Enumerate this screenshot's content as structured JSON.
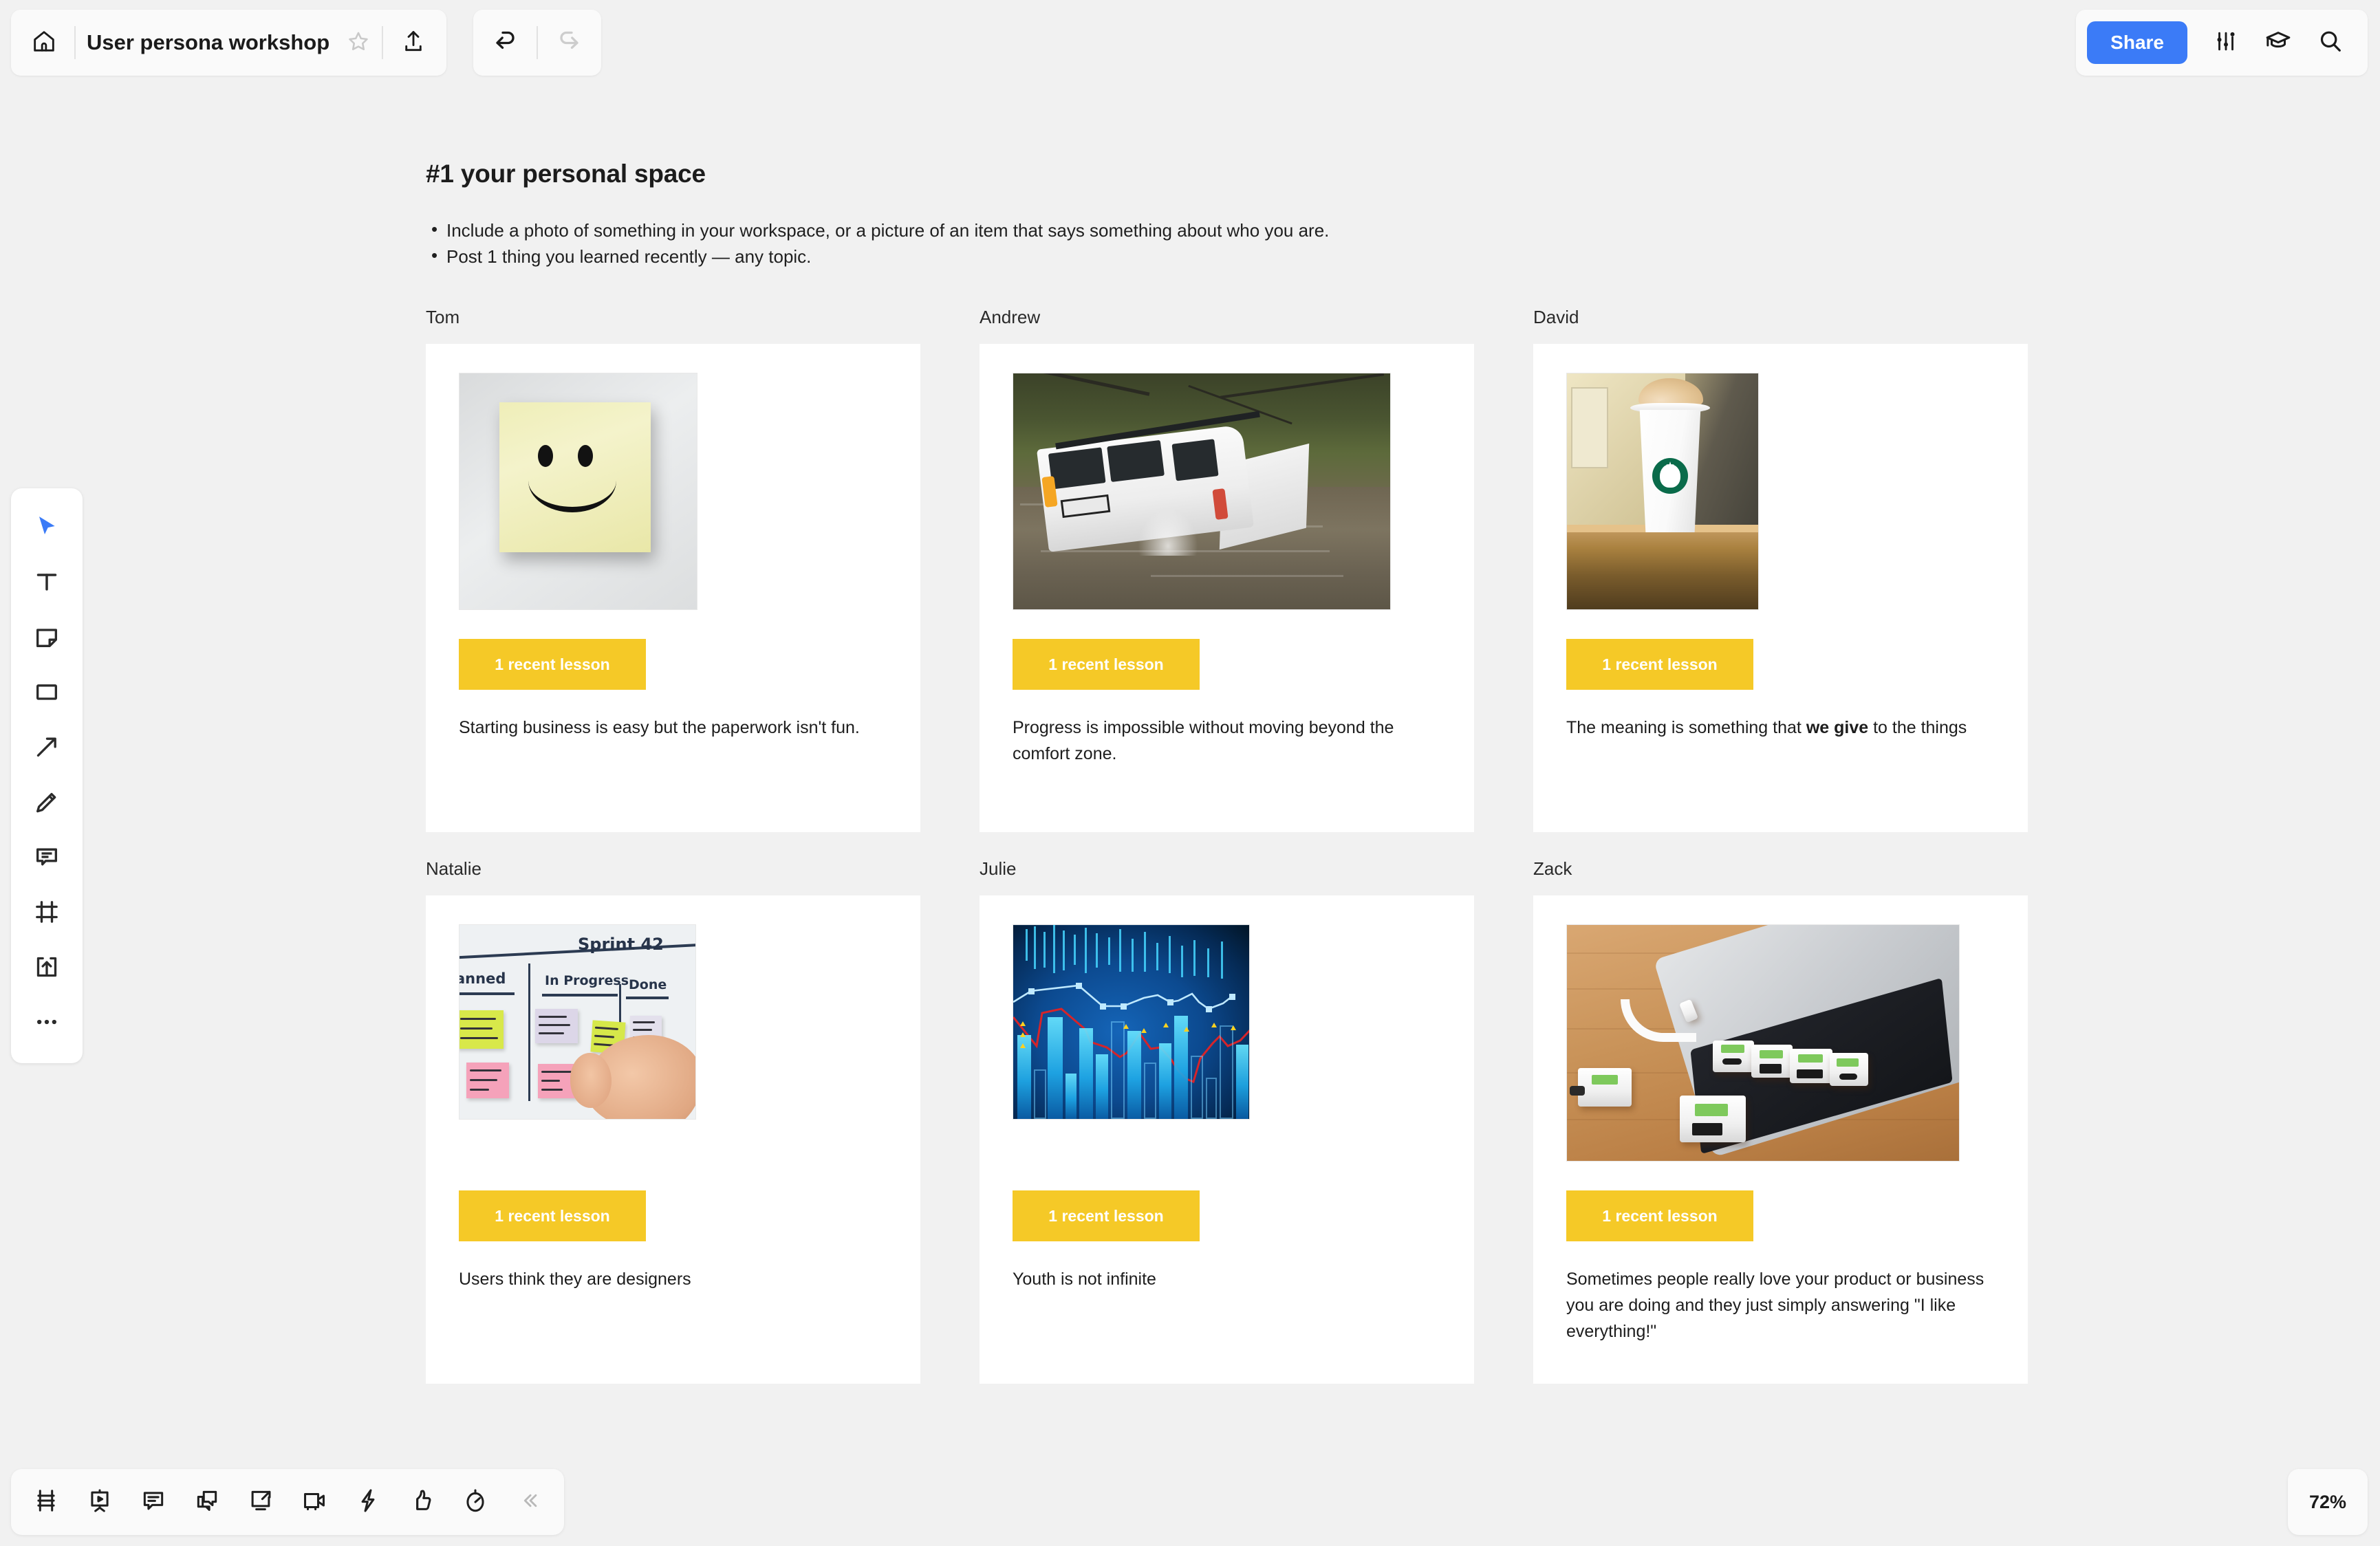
{
  "app": {
    "zoom_level": "72%",
    "accent_blue": "#3b7bf7",
    "sticky_yellow": "#f5c927",
    "canvas_bg": "#f1f1f1"
  },
  "topbar": {
    "home_icon": "home-icon",
    "document_title": "User persona workshop",
    "star_icon": "star-outline-icon",
    "upload_icon": "upload-icon",
    "undo_icon": "undo-arrow-icon",
    "redo_icon": "redo-arrow-icon",
    "share_label": "Share",
    "settings_icon": "sliders-icon",
    "learn_icon": "graduation-cap-icon",
    "search_icon": "magnifier-icon"
  },
  "left_toolbar": {
    "tools": [
      {
        "name": "select-tool",
        "icon": "cursor-arrow-icon",
        "selected": true
      },
      {
        "name": "text-tool",
        "icon": "text-t-icon",
        "selected": false
      },
      {
        "name": "sticky-note-tool",
        "icon": "sticky-note-icon",
        "selected": false
      },
      {
        "name": "shape-tool",
        "icon": "rectangle-icon",
        "selected": false
      },
      {
        "name": "connector-tool",
        "icon": "arrow-line-icon",
        "selected": false
      },
      {
        "name": "pen-tool",
        "icon": "pencil-icon",
        "selected": false
      },
      {
        "name": "comment-tool",
        "icon": "comment-bubble-icon",
        "selected": false
      },
      {
        "name": "frame-tool",
        "icon": "frame-icon",
        "selected": false
      },
      {
        "name": "upload-tool",
        "icon": "upload-box-icon",
        "selected": false
      },
      {
        "name": "more-tools",
        "icon": "ellipsis-icon",
        "selected": false
      }
    ]
  },
  "bottom_toolbar": {
    "items": [
      {
        "name": "frames-panel-button",
        "icon": "frames-icon"
      },
      {
        "name": "presentation-button",
        "icon": "presentation-easel-icon"
      },
      {
        "name": "comments-button",
        "icon": "comment-list-icon"
      },
      {
        "name": "chat-button",
        "icon": "chat-bubbles-icon"
      },
      {
        "name": "screen-share-button",
        "icon": "screen-share-icon"
      },
      {
        "name": "video-chat-button",
        "icon": "video-camera-icon"
      },
      {
        "name": "apps-button",
        "icon": "lightning-bolt-icon"
      },
      {
        "name": "reactions-button",
        "icon": "thumbs-up-icon"
      },
      {
        "name": "timer-button",
        "icon": "stopwatch-icon"
      },
      {
        "name": "collapse-button",
        "icon": "chevron-double-left-icon"
      }
    ]
  },
  "board": {
    "title": "#1 your personal space",
    "bullets": [
      "Include a photo of something in your workspace, or a picture of an item that says something about who you are.",
      "Post 1 thing you learned recently — any topic."
    ],
    "lesson_chip_label": "1 recent lesson",
    "cards": [
      {
        "person": "Tom",
        "image_alt": "yellow-sticky-note-smiley-face-on-wall",
        "lesson_before_bold": "Starting business is easy but the paperwork isn't fun.",
        "lesson_bold": "",
        "lesson_after_bold": ""
      },
      {
        "person": "Andrew",
        "image_alt": "white-van-submerged-in-flood-water",
        "lesson_before_bold": "Progress is impossible without moving beyond the comfort zone.",
        "lesson_bold": "",
        "lesson_after_bold": ""
      },
      {
        "person": "David",
        "image_alt": "starbucks-coffee-cup-with-whipped-cream-on-counter",
        "lesson_before_bold": "The meaning is something that ",
        "lesson_bold": "we give",
        "lesson_after_bold": " to the things"
      },
      {
        "person": "Natalie",
        "image_alt": "whiteboard-kanban-sprint-42-with-sticky-notes-and-hand",
        "lesson_before_bold": "Users think they are designers",
        "lesson_bold": "",
        "lesson_after_bold": ""
      },
      {
        "person": "Julie",
        "image_alt": "blue-financial-market-chart-with-bars-and-lines",
        "lesson_before_bold": "Youth is not infinite",
        "lesson_bold": "",
        "lesson_after_bold": ""
      },
      {
        "person": "Zack",
        "image_alt": "modular-usb-hub-adapters-connected-to-laptop-on-desk",
        "lesson_before_bold": "Sometimes people really love your product or business you are doing and they just simply answering \"I like everything!\"",
        "lesson_bold": "",
        "lesson_after_bold": ""
      }
    ]
  }
}
